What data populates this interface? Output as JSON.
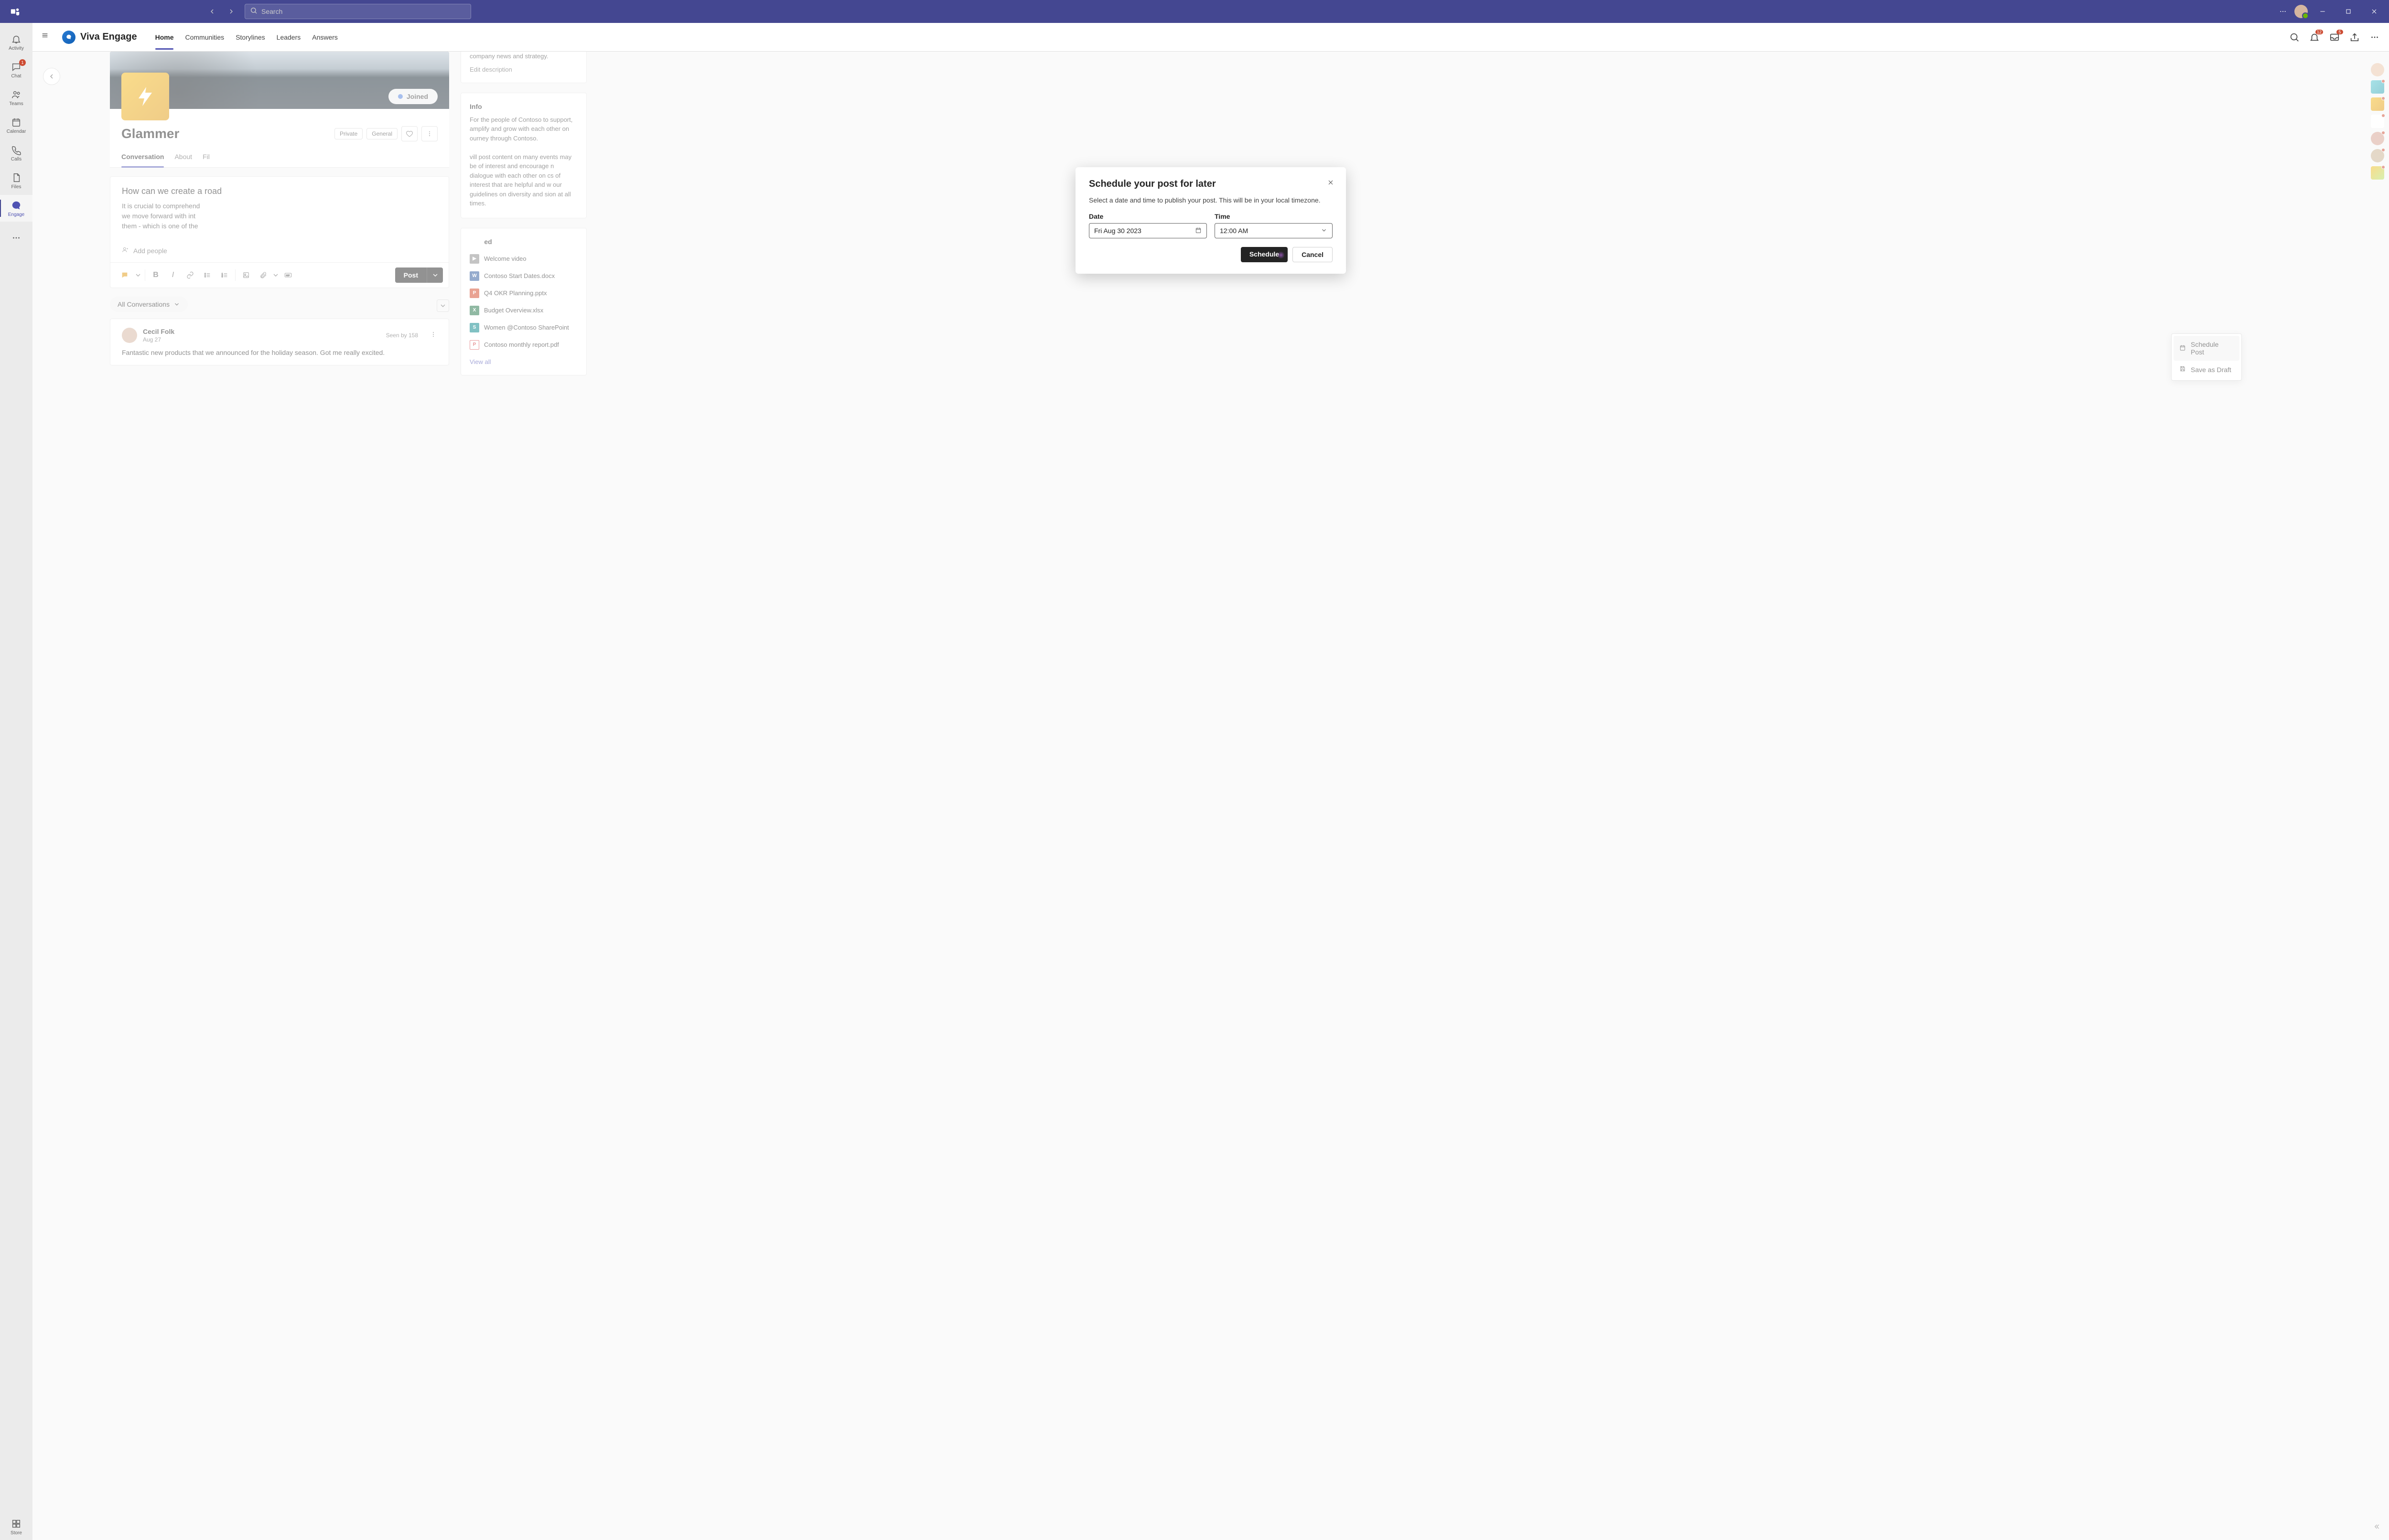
{
  "titlebar": {
    "search_placeholder": "Search"
  },
  "app_rail": {
    "items": [
      {
        "label": "Activity",
        "icon": "bell"
      },
      {
        "label": "Chat",
        "icon": "chat",
        "badge": "1"
      },
      {
        "label": "Teams",
        "icon": "people"
      },
      {
        "label": "Calendar",
        "icon": "calendar"
      },
      {
        "label": "Calls",
        "icon": "phone"
      },
      {
        "label": "Files",
        "icon": "files"
      },
      {
        "label": "Engage",
        "icon": "engage",
        "active": true
      }
    ],
    "store_label": "Store"
  },
  "engage_header": {
    "brand": "Viva Engage",
    "nav": [
      "Home",
      "Communities",
      "Storylines",
      "Leaders",
      "Answers"
    ],
    "active_nav": "Home",
    "notif_badge": "12",
    "inbox_badge": "5"
  },
  "community": {
    "name": "Glammer",
    "joined_label": "Joined",
    "chips": [
      "Private",
      "General"
    ],
    "tabs": [
      "Conversation",
      "About",
      "Fil"
    ],
    "active_tab": "Conversation"
  },
  "composer": {
    "question": "How can we create a road",
    "body": "It is crucial to comprehend\nwe move forward with int\nthem - which is one of the",
    "add_people_placeholder": "Add people",
    "post_label": "Post",
    "dropdown": {
      "schedule": "Schedule Post",
      "draft": "Save as Draft"
    }
  },
  "filter": {
    "all_label": "All Conversations"
  },
  "feed": {
    "post": {
      "author": "Cecil Folk",
      "date": "Aug 27",
      "seen": "Seen by 158",
      "body": "Fantastic new products that we announced for the holiday season. Got me really excited."
    }
  },
  "sidebar": {
    "desc_top": "company news and strategy.",
    "edit_label": "Edit description",
    "info_title": "Info",
    "info_text": "For the people of Contoso to support, amplify and grow with each other on            ourney through Contoso.\n\n            vill post content on many events            may be of interest and encourage            n dialogue with each other on            cs of interest that are helpful and            w our guidelines on diversity and            sion at all times.",
    "pinned_title": "ed",
    "pinned": [
      {
        "label": "Welcome video",
        "type": "video",
        "color": "#888"
      },
      {
        "label": "Contoso Start Dates.docx",
        "type": "word",
        "color": "#2b579a"
      },
      {
        "label": "Q4 OKR Planning.pptx",
        "type": "ppt",
        "color": "#d24726"
      },
      {
        "label": "Budget Overview.xlsx",
        "type": "xls",
        "color": "#217346"
      },
      {
        "label": "Women @Contoso SharePoint",
        "type": "sp",
        "color": "#038387"
      },
      {
        "label": "Contoso monthly report.pdf",
        "type": "pdf",
        "color": "#d13438"
      }
    ],
    "view_all": "View all"
  },
  "modal": {
    "title": "Schedule your post for later",
    "subtitle": "Select a date and time to publish your post. This will be in your local timezone.",
    "date_label": "Date",
    "date_value": "Fri Aug 30 2023",
    "time_label": "Time",
    "time_value": "12:00 AM",
    "schedule_btn": "Schedule",
    "cancel_btn": "Cancel"
  }
}
